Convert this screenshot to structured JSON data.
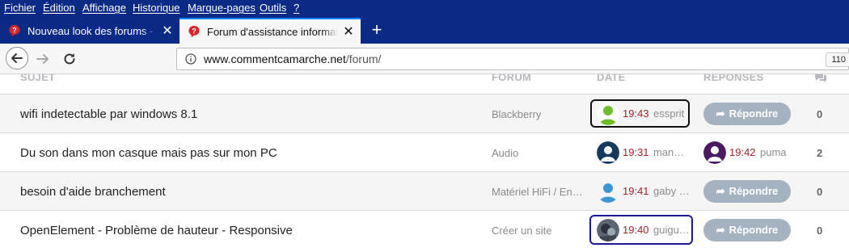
{
  "menu": [
    "Fichier",
    "Édition",
    "Affichage",
    "Historique",
    "Marque-pages",
    "Outils",
    "?"
  ],
  "tabs": [
    {
      "title": "Nouveau look des forums - Page"
    },
    {
      "title": "Forum d'assistance informatique"
    }
  ],
  "toolbar": {
    "url_host": "www.commentcamarche.net",
    "url_path": "/forum/",
    "zoom": "110"
  },
  "table": {
    "headers": {
      "subject": "SUJET",
      "forum": "FORUM",
      "date": "DATE",
      "replies": "RÉPONSES"
    },
    "reply_label": "Répondre",
    "rows": [
      {
        "subject": "wifi indetectable par windows 8.1",
        "forum": "Blackberry",
        "time": "19:43",
        "user": "essprit",
        "replies": "0"
      },
      {
        "subject": "Du son dans mon casque mais pas sur mon PC",
        "forum": "Audio",
        "time": "19:31",
        "user": "man…",
        "last_time": "19:42",
        "last_user": "puma",
        "replies": "2"
      },
      {
        "subject": "besoin d'aide branchement",
        "forum": "Matériel HiFi / En…",
        "time": "19:41",
        "user": "gaby …",
        "replies": "0"
      },
      {
        "subject": "OpenElement - Problème de hauteur - Responsive",
        "forum": "Créer un site",
        "time": "19:40",
        "user": "guigu…",
        "replies": "0"
      }
    ]
  },
  "colors": {
    "menu_bg": "#0a2a86",
    "time_red": "#a3212b",
    "reply_btn": "#a5b3c1"
  }
}
